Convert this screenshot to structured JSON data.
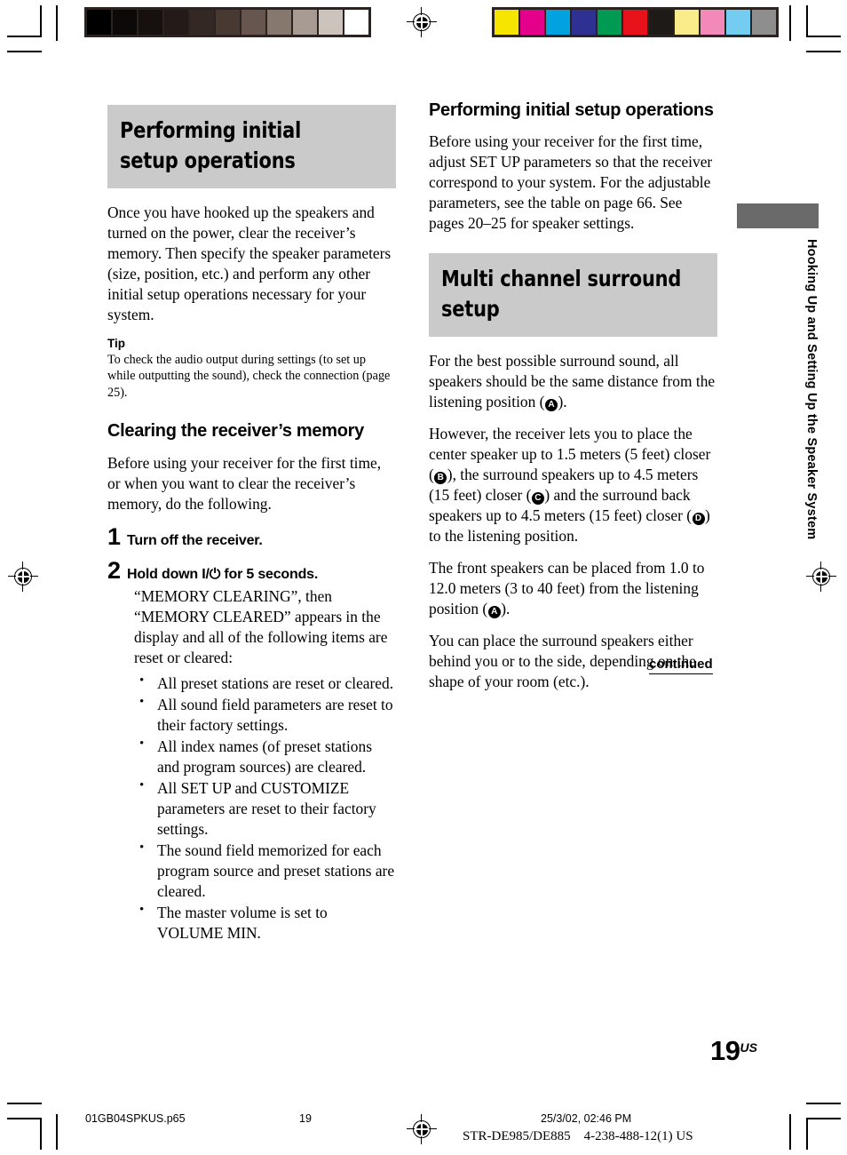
{
  "document": {
    "page_number": "19",
    "page_suffix": "US",
    "side_tab_label": "Hooking Up and Setting Up the Speaker System",
    "continued_label": "continued"
  },
  "left_column": {
    "heading": "Performing initial setup operations",
    "intro": "Once you have hooked up the speakers and turned on the power, clear the receiver’s memory. Then specify the speaker parameters (size, position, etc.) and perform any other initial setup operations necessary for your system.",
    "tip_label": "Tip",
    "tip_text": "To check the audio output during settings (to set up while outputting the sound), check the connection (page 25).",
    "subheading": "Clearing the receiver’s memory",
    "sub_intro": "Before using your receiver for the first time, or when you want to clear the receiver’s memory, do the following.",
    "steps": [
      {
        "number": "1",
        "title": "Turn off the receiver.",
        "body": ""
      },
      {
        "number": "2",
        "title_prefix": "Hold down ",
        "power_symbol": "I/⏻",
        "title_suffix": " for 5 seconds.",
        "body": "“MEMORY CLEARING”, then “MEMORY CLEARED” appears in the display and all of the following items are reset or cleared:"
      }
    ],
    "bullets": [
      "All preset stations are reset or cleared.",
      "All sound field parameters are reset to their factory settings.",
      "All index names (of preset stations and program sources) are cleared.",
      "All SET UP and CUSTOMIZE parameters are reset to their factory settings.",
      "The sound field memorized for each program source and preset stations are cleared.",
      "The master volume is set to VOLUME MIN."
    ]
  },
  "right_column": {
    "heading": "Performing initial setup operations",
    "intro": "Before using your receiver for the first time, adjust SET UP parameters so that the receiver correspond to your system. For the adjustable parameters, see the table on page 66. See pages 20–25 for speaker settings.",
    "band_heading": "Multi channel surround setup",
    "para1_a": "For the best possible surround sound, all speakers should be the same distance from the listening position (",
    "para1_marker": "A",
    "para1_b": ").",
    "para2_a": "However, the receiver lets you to place the center speaker up to 1.5 meters (5 feet) closer (",
    "para2_marker1": "B",
    "para2_b": "), the surround speakers up to 4.5 meters (15 feet) closer (",
    "para2_marker2": "C",
    "para2_c": ") and the surround back speakers up to 4.5 meters (15 feet) closer (",
    "para2_marker3": "D",
    "para2_d": ") to the listening position.",
    "para3_a": "The front speakers can be placed from 1.0 to 12.0 meters (3 to 40 feet) from the listening position (",
    "para3_marker": "A",
    "para3_b": ").",
    "para4": "You can place the surround speakers either behind you or to the side, depending on the shape of your room (etc.)."
  },
  "print_footer": {
    "file_name": "01GB04SPKUS.p65",
    "page": "19",
    "timestamp": "25/3/02, 02:46 PM",
    "model_line": "STR-DE985/DE885    4-238-488-12(1) US"
  },
  "calibration": {
    "grayscale_swatches": [
      "#000000",
      "#0d0908",
      "#17100e",
      "#241b18",
      "#332823",
      "#483a33",
      "#66564f",
      "#87786f",
      "#a89b93",
      "#cdc3bd",
      "#ffffff"
    ],
    "color_swatches": [
      "#f5e500",
      "#e5008c",
      "#00a2e0",
      "#2e3192",
      "#009a52",
      "#e8121b",
      "#1e1a18",
      "#faeb8b",
      "#f289b8",
      "#74cdf0",
      "#8e8e8e"
    ]
  }
}
